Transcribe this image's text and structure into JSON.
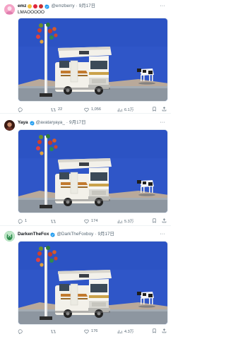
{
  "colors": {
    "sky": "#2f56c8",
    "ground": "#8d96a0",
    "verified": "#1d9bf0",
    "muted": "#536471",
    "text": "#0f1419"
  },
  "posts": [
    {
      "display_name": "emz",
      "handle": "@emzberry",
      "separator": "·",
      "time": "9月17日",
      "text": "LMAOOOOO",
      "replies": "",
      "reposts": "22",
      "likes": "1,056",
      "views": "6.1万",
      "avatar_color": "#f4a3c6",
      "icons": [
        "reply-icon",
        "repost-icon",
        "like-icon",
        "views-icon",
        "bookmark-icon",
        "share-icon"
      ]
    },
    {
      "display_name": "Yaya",
      "handle": "@avataryaya_",
      "separator": "·",
      "time": "9月17日",
      "text": "",
      "replies": "1",
      "reposts": "",
      "likes": "174",
      "views": "5.3万",
      "avatar_color": "#5b2a1e",
      "icons": [
        "reply-icon",
        "repost-icon",
        "like-icon",
        "views-icon",
        "bookmark-icon",
        "share-icon"
      ]
    },
    {
      "display_name": "DarkenTheFox",
      "handle": "@DarkTheFoxboy",
      "separator": "·",
      "time": "9月17日",
      "text": "",
      "replies": "",
      "reposts": "",
      "likes": "176",
      "views": "4.3万",
      "avatar_color": "#3aa35a",
      "icons": [
        "reply-icon",
        "repost-icon",
        "like-icon",
        "views-icon",
        "bookmark-icon",
        "share-icon"
      ]
    }
  ]
}
